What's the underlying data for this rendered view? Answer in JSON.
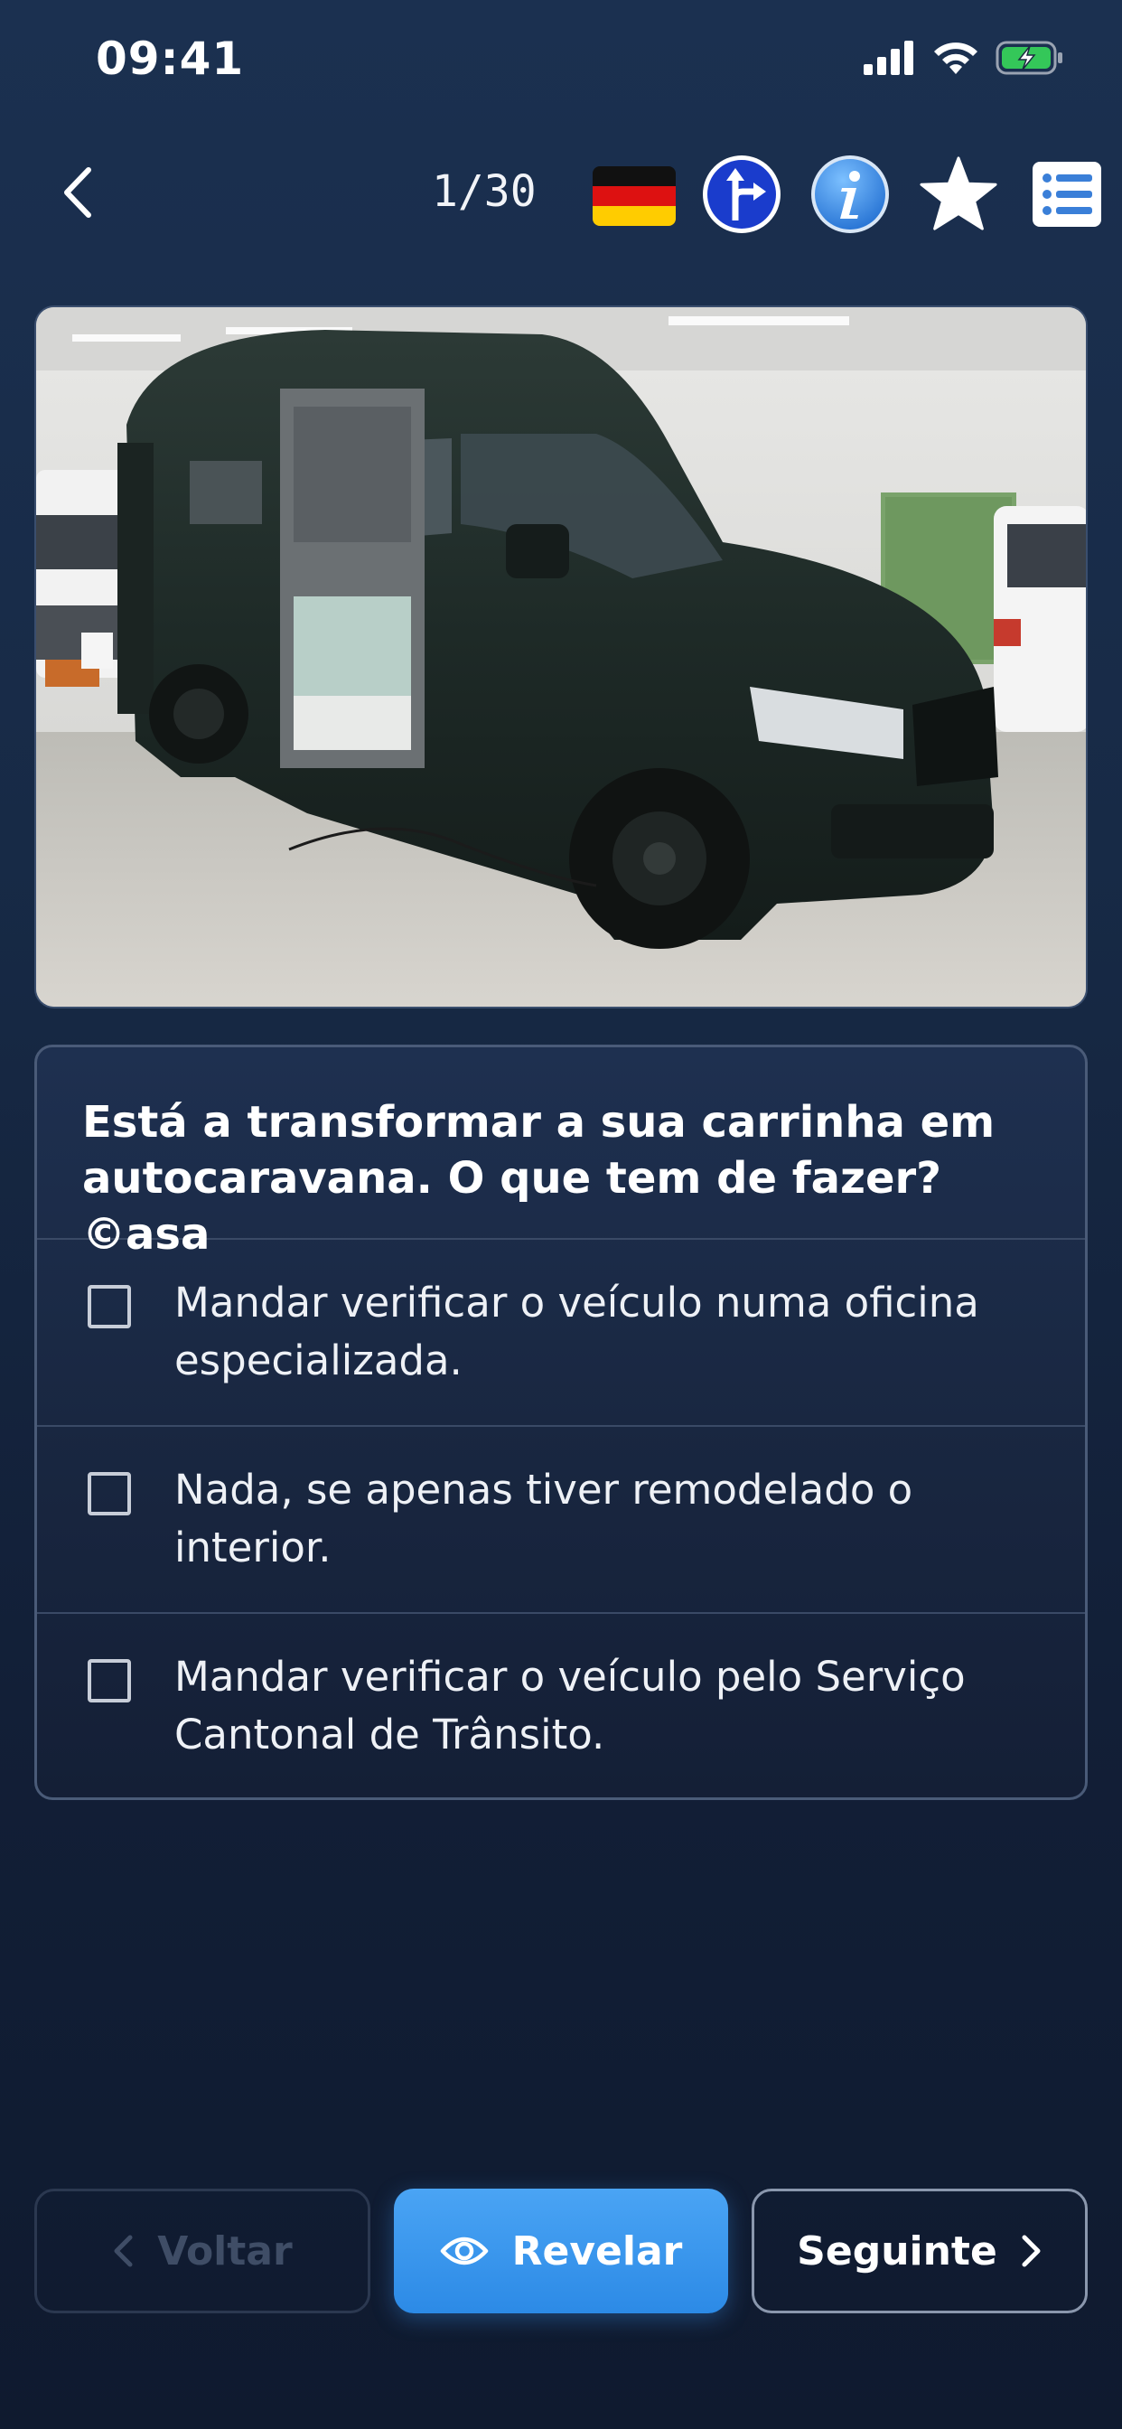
{
  "status_bar": {
    "time": "09:41"
  },
  "header": {
    "progress": "1/30",
    "icons": [
      "back-chevron-icon",
      "german-flag-icon",
      "road-sign-directions-icon",
      "info-icon",
      "star-icon",
      "list-icon"
    ]
  },
  "question": {
    "text": "Está a transformar a sua carrinha em autocaravana. O que tem de fazer? ©asa",
    "image": "dark-green-campervan-in-garage",
    "options": [
      {
        "text": "Mandar verificar o veículo numa oficina especializada.",
        "checked": false
      },
      {
        "text": "Nada, se apenas tiver remodelado o interior.",
        "checked": false
      },
      {
        "text": "Mandar verificar o veículo pelo Serviço Cantonal de Trânsito.",
        "checked": false
      }
    ]
  },
  "footer": {
    "back_label": "Voltar",
    "reveal_label": "Revelar",
    "next_label": "Seguinte"
  },
  "colors": {
    "accent": "#3b96ee",
    "background": "#172a46",
    "info_icon": "#3c8be0",
    "sign_blue": "#1a3ccc"
  }
}
